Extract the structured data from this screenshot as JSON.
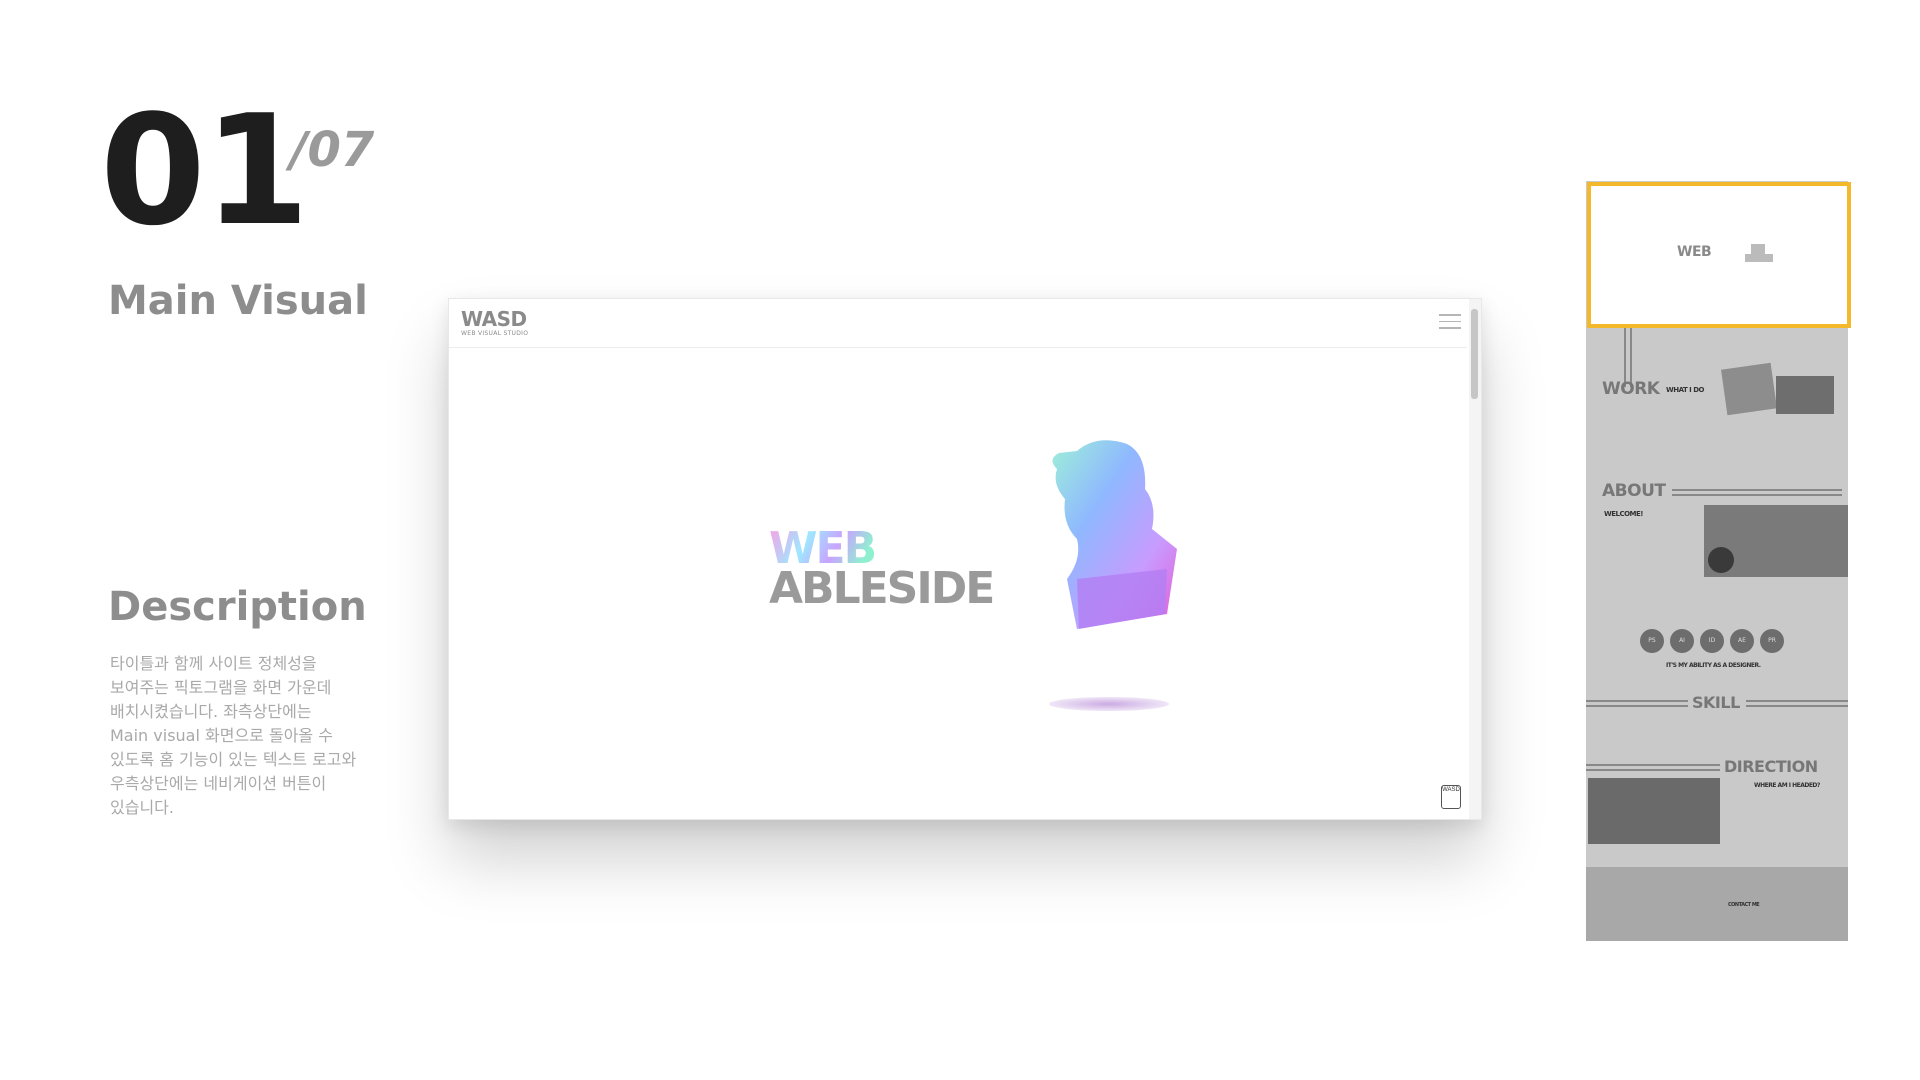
{
  "slide": {
    "number": "01",
    "total": "/07",
    "section_title": "Main Visual",
    "description_heading": "Description",
    "description_lines": [
      "타이틀과 함께 사이트 정체성을",
      "보여주는 픽토그램을 화면 가운데",
      "배치시켰습니다. 좌측상단에는",
      "Main visual 화면으로 돌아올 수",
      "있도록 홈 기능이 있는 텍스트 로고와",
      "우측상단에는 네비게이션 버튼이",
      "있습니다."
    ]
  },
  "mock": {
    "logo": "WASD",
    "logo_sub": "WEB VISUAL STUDIO",
    "hero_line1": "WEB",
    "hero_line2": "ABLESIDE",
    "badge": "WASD"
  },
  "strip": {
    "hero_logo": "WEB",
    "work_title": "WORK",
    "work_sub": "WHAT I DO",
    "about_title": "ABOUT",
    "about_sub": "WELCOME!",
    "skills": [
      "PS",
      "AI",
      "ID",
      "AE",
      "PR"
    ],
    "skill_caption": "IT'S MY ABILITY AS A DESIGNER.",
    "skill_title": "SKILL",
    "direction_title": "DIRECTION",
    "direction_sub": "WHERE AM I HEADED?",
    "footer_label": "CONTACT ME"
  },
  "colors": {
    "highlight": "#f3b92b",
    "strip_bg": "#c9c9c9"
  }
}
